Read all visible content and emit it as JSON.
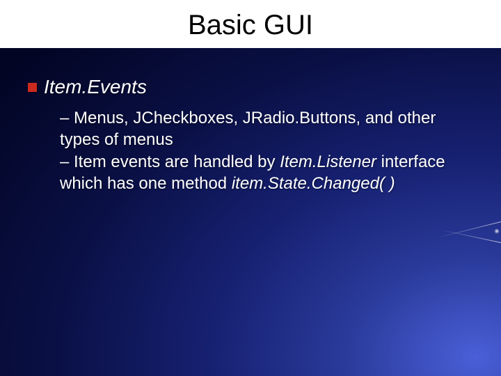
{
  "title": "Basic GUI",
  "section_heading": "Item.Events",
  "sub_items": [
    {
      "dash": "– ",
      "parts": [
        {
          "text": "Menus, JCheckboxes, JRadio.Buttons, and other types of menus",
          "italic": false
        }
      ]
    },
    {
      "dash": "– ",
      "parts": [
        {
          "text": "Item events are handled by ",
          "italic": false
        },
        {
          "text": "Item.Listener",
          "italic": true
        },
        {
          "text": " interface which has one method ",
          "italic": false
        },
        {
          "text": "item.State.Changed( )",
          "italic": true
        }
      ]
    }
  ]
}
